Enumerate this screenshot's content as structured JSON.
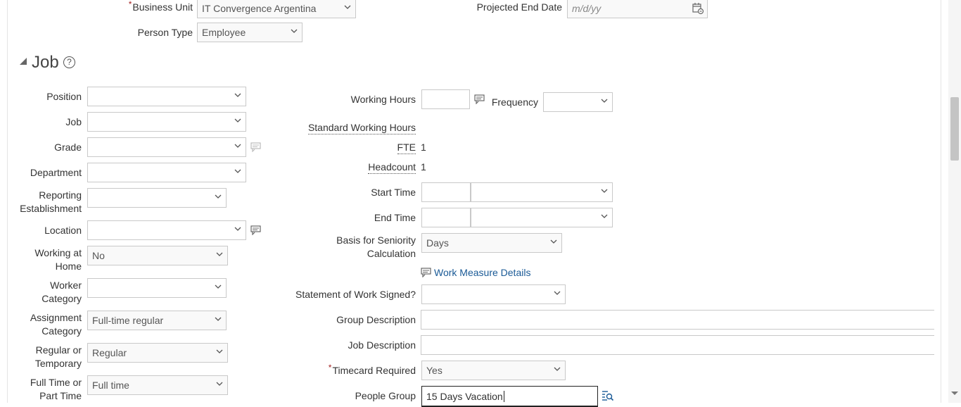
{
  "top": {
    "business_unit_label": "Business Unit",
    "business_unit_value": "IT Convergence Argentina",
    "projected_end_label": "Projected End Date",
    "projected_end_placeholder": "m/d/yy",
    "person_type_label": "Person Type",
    "person_type_value": "Employee"
  },
  "section": {
    "title": "Job",
    "help_glyph": "?"
  },
  "left": {
    "position_label": "Position",
    "job_label": "Job",
    "grade_label": "Grade",
    "department_label": "Department",
    "reporting_label_1": "Reporting",
    "reporting_label_2": "Establishment",
    "location_label": "Location",
    "working_home_label_1": "Working at",
    "working_home_label_2": "Home",
    "working_home_value": "No",
    "worker_cat_label_1": "Worker",
    "worker_cat_label_2": "Category",
    "assignment_cat_label_1": "Assignment",
    "assignment_cat_label_2": "Category",
    "assignment_cat_value": "Full-time regular",
    "regular_temp_label_1": "Regular or",
    "regular_temp_label_2": "Temporary",
    "regular_temp_value": "Regular",
    "fulltime_label_1": "Full Time or",
    "fulltime_label_2": "Part Time",
    "fulltime_value": "Full time"
  },
  "right": {
    "working_hours_label": "Working Hours",
    "frequency_label": "Frequency",
    "std_working_hours_label": "Standard Working Hours",
    "fte_label": "FTE",
    "fte_value": "1",
    "headcount_label": "Headcount",
    "headcount_value": "1",
    "start_time_label": "Start Time",
    "end_time_label": "End Time",
    "seniority_label_1": "Basis for Seniority",
    "seniority_label_2": "Calculation",
    "seniority_value": "Days",
    "work_measure_link": "Work Measure Details",
    "sow_label": "Statement of Work Signed?",
    "group_desc_label": "Group Description",
    "job_desc_label": "Job Description",
    "timecard_label": "Timecard Required",
    "timecard_value": "Yes",
    "people_group_label": "People Group",
    "people_group_value": "15 Days Vacation"
  },
  "icons": {
    "calendar": "calendar-icon",
    "chevron": "chevron-down-icon",
    "details": "details-icon",
    "search": "search-list-icon"
  },
  "colors": {
    "link": "#1a5a96",
    "required": "#a32323"
  }
}
